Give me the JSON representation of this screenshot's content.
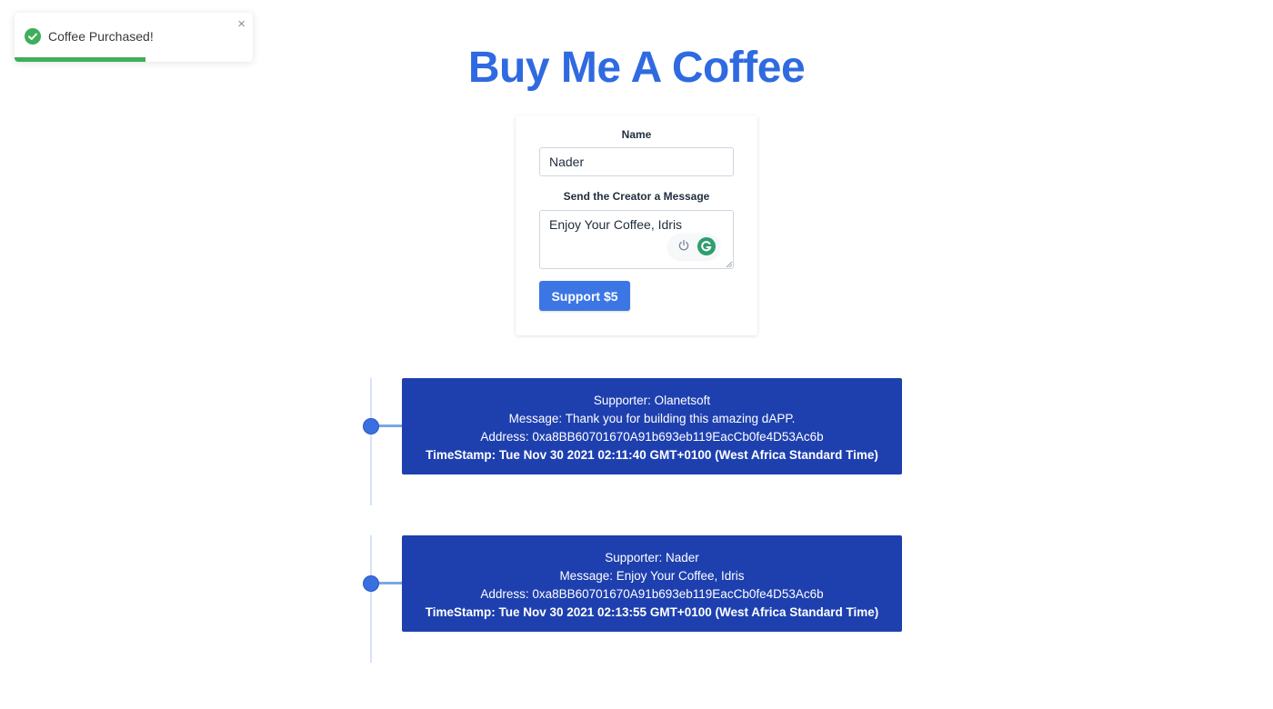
{
  "toast": {
    "message": "Coffee Purchased!",
    "close_glyph": "×",
    "icon": "check-circle-icon",
    "progress_fraction": 0.55,
    "color": "#3fae5a"
  },
  "page": {
    "title": "Buy Me A Coffee",
    "accent_color": "#2f6ae0"
  },
  "form": {
    "name_label": "Name",
    "name_value": "Nader",
    "message_label": "Send the Creator a Message",
    "message_value": "Enjoy Your Coffee, Idris",
    "submit_label": "Support $5",
    "button_color": "#3b76e4"
  },
  "memos": [
    {
      "supporter": "Supporter: Olanetsoft",
      "message": "Message: Thank you for building this amazing dAPP.",
      "address": "Address: 0xa8BB60701670A91b693eb119EacCb0fe4D53Ac6b",
      "timestamp": "TimeStamp: Tue Nov 30 2021 02:11:40 GMT+0100 (West Africa Standard Time)"
    },
    {
      "supporter": "Supporter: Nader",
      "message": "Message: Enjoy Your Coffee, Idris",
      "address": "Address: 0xa8BB60701670A91b693eb119EacCb0fe4D53Ac6b",
      "timestamp": "TimeStamp: Tue Nov 30 2021 02:13:55 GMT+0100 (West Africa Standard Time)"
    }
  ],
  "memo_card_color": "#1e40af"
}
